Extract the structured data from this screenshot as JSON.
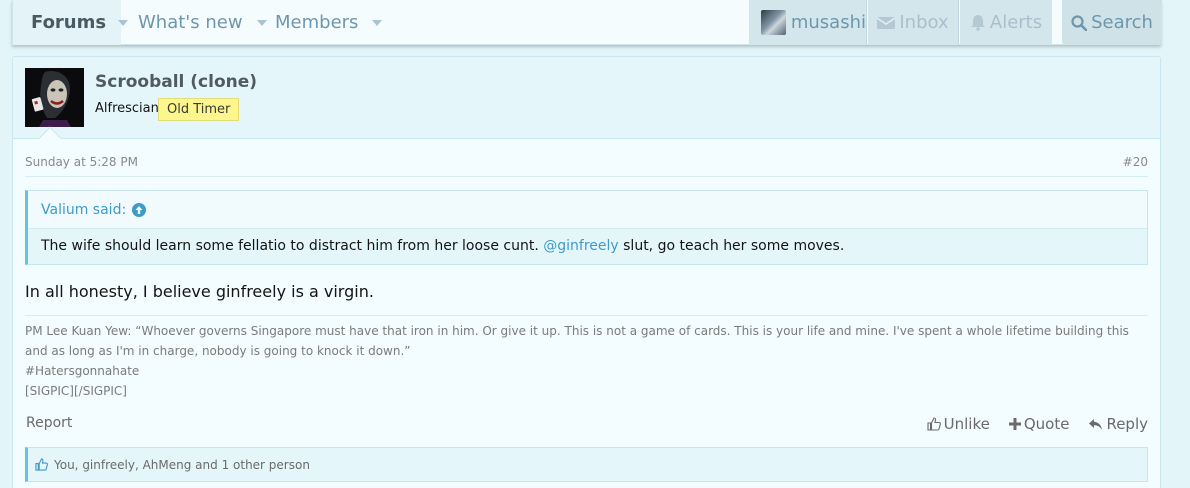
{
  "nav": {
    "tabs": [
      {
        "label": "Forums"
      },
      {
        "label": "What's new"
      },
      {
        "label": "Members"
      }
    ],
    "user": {
      "name": "musashi"
    },
    "inbox_label": "Inbox",
    "alerts_label": "Alerts",
    "search_label": "Search"
  },
  "post": {
    "author": {
      "username": "Scrooball (clone)",
      "title": "Alfrescian",
      "badge": "Old Timer"
    },
    "date": "Sunday at 5:28 PM",
    "number": "#20",
    "quote": {
      "author_label": "Valium said:",
      "text_before": "The wife should learn some fellatio to distract him from her loose cunt. ",
      "mention": "@ginfreely",
      "text_after": " slut, go teach her some moves."
    },
    "message": "In all honesty, I believe ginfreely is a virgin.",
    "signature": [
      "PM Lee Kuan Yew: “Whoever governs Singapore must have that iron in him. Or give it up. This is not a game of cards. This is your life and mine. I've spent a whole lifetime building this and as long as I'm in charge, nobody is going to knock it down.”",
      "#Hatersgonnahate",
      "[SIGPIC][/SIGPIC]"
    ],
    "report_label": "Report",
    "actions": {
      "unlike": "Unlike",
      "quote": "Quote",
      "reply": "Reply"
    },
    "likes_text": "You, ginfreely, AhMeng and 1 other person"
  },
  "colors": {
    "accent": "#3d9bc9",
    "badge_bg": "#fdf68d",
    "page_bg": "#e3f5f9"
  },
  "icons": [
    "user-avatar-icon",
    "envelope-icon",
    "bell-icon",
    "search-icon",
    "arrow-up-circle-icon",
    "thumbs-up-icon",
    "plus-icon",
    "reply-icon"
  ]
}
